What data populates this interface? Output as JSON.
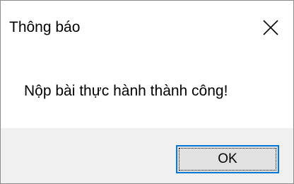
{
  "dialog": {
    "title": "Thông báo",
    "message": "Nộp bài thực hành thành công!",
    "close_icon": "close-icon",
    "ok_label": "OK"
  },
  "colors": {
    "footer_bg": "#f0f0f0",
    "button_bg": "#e1e1e1",
    "button_focus_border": "#0078d7",
    "window_border": "#8c8c8c"
  }
}
